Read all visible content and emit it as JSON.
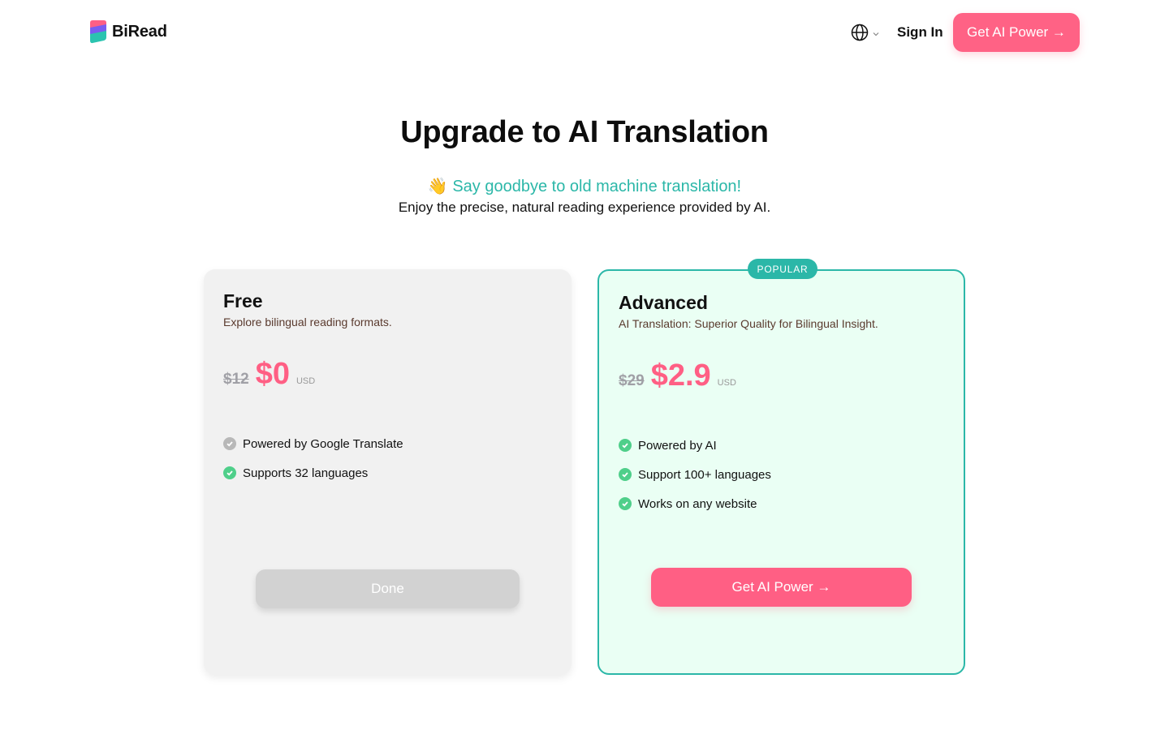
{
  "header": {
    "brand": "BiRead",
    "sign_in": "Sign In",
    "cta": "Get AI Power →",
    "icons": {
      "language": "globe-icon",
      "dropdown": "chevron-down-icon"
    }
  },
  "hero": {
    "title": "Upgrade to AI Translation",
    "subtitle": "👋 Say goodbye to old machine translation!",
    "description": "Enjoy the precise, natural reading experience provided by AI."
  },
  "plans": {
    "free": {
      "name": "Free",
      "tagline": "Explore bilingual reading formats.",
      "old_price": "$12",
      "price": "$0",
      "currency": "USD",
      "features": [
        {
          "text": "Powered by Google Translate",
          "status": "gray"
        },
        {
          "text": "Supports 32 languages",
          "status": "green"
        }
      ],
      "button": "Done"
    },
    "advanced": {
      "badge": "POPULAR",
      "name": "Advanced",
      "tagline": "AI Translation: Superior Quality for Bilingual Insight.",
      "old_price": "$29",
      "price": "$2.9",
      "currency": "USD",
      "features": [
        {
          "text": "Powered by AI",
          "status": "green"
        },
        {
          "text": "Support 100+ languages",
          "status": "green"
        },
        {
          "text": "Works on any website",
          "status": "green"
        }
      ],
      "button": "Get AI Power →"
    }
  },
  "colors": {
    "accent_pink": "#ff6285",
    "accent_teal": "#2bb7a8",
    "check_green": "#4fcf8a",
    "card_free_bg": "#f1f1f1",
    "card_adv_bg": "#eafff4"
  }
}
